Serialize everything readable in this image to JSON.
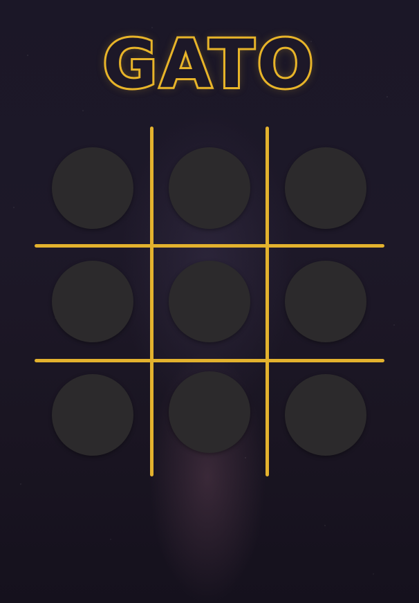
{
  "title": "GATO",
  "colors": {
    "accent": "#e3b22e",
    "cell_fill": "#2c2a2c",
    "background": "#1b1727"
  },
  "board": {
    "cells": [
      {
        "mark": ""
      },
      {
        "mark": ""
      },
      {
        "mark": ""
      },
      {
        "mark": ""
      },
      {
        "mark": ""
      },
      {
        "mark": ""
      },
      {
        "mark": ""
      },
      {
        "mark": ""
      },
      {
        "mark": ""
      }
    ]
  }
}
